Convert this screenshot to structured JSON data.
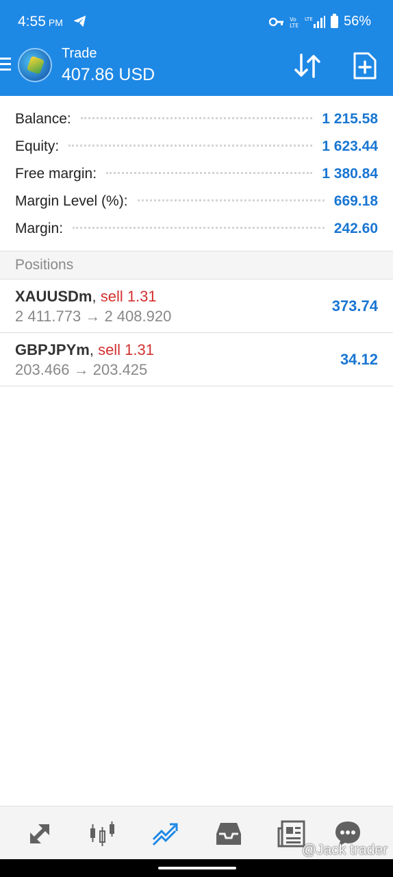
{
  "status_bar": {
    "time": "4:55",
    "ampm": "PM",
    "network": "LTE",
    "battery": "56%"
  },
  "app_bar": {
    "title": "Trade",
    "balance": "407.86 USD"
  },
  "summary": [
    {
      "label": "Balance:",
      "value": "1 215.58"
    },
    {
      "label": "Equity:",
      "value": "1 623.44"
    },
    {
      "label": "Free margin:",
      "value": "1 380.84"
    },
    {
      "label": "Margin Level (%):",
      "value": "669.18"
    },
    {
      "label": "Margin:",
      "value": "242.60"
    }
  ],
  "positions": {
    "header": "Positions",
    "items": [
      {
        "symbol": "XAUUSDm",
        "side": "sell 1.31",
        "prices": "2 411.773 → 2 408.920",
        "profit": "373.74"
      },
      {
        "symbol": "GBPJPYm",
        "side": "sell 1.31",
        "prices": "203.466 → 203.425",
        "profit": "34.12"
      }
    ]
  },
  "bottom_nav": {
    "items": [
      {
        "icon": "quotes-icon"
      },
      {
        "icon": "chart-candles-icon"
      },
      {
        "icon": "trade-icon",
        "active": true
      },
      {
        "icon": "history-inbox-icon"
      },
      {
        "icon": "news-icon"
      },
      {
        "icon": "messages-icon"
      }
    ],
    "watermark": "@Jack trader"
  },
  "colors": {
    "primary": "#1e88e5",
    "value_blue": "#1976d2",
    "sell_red": "#d32f2f"
  }
}
